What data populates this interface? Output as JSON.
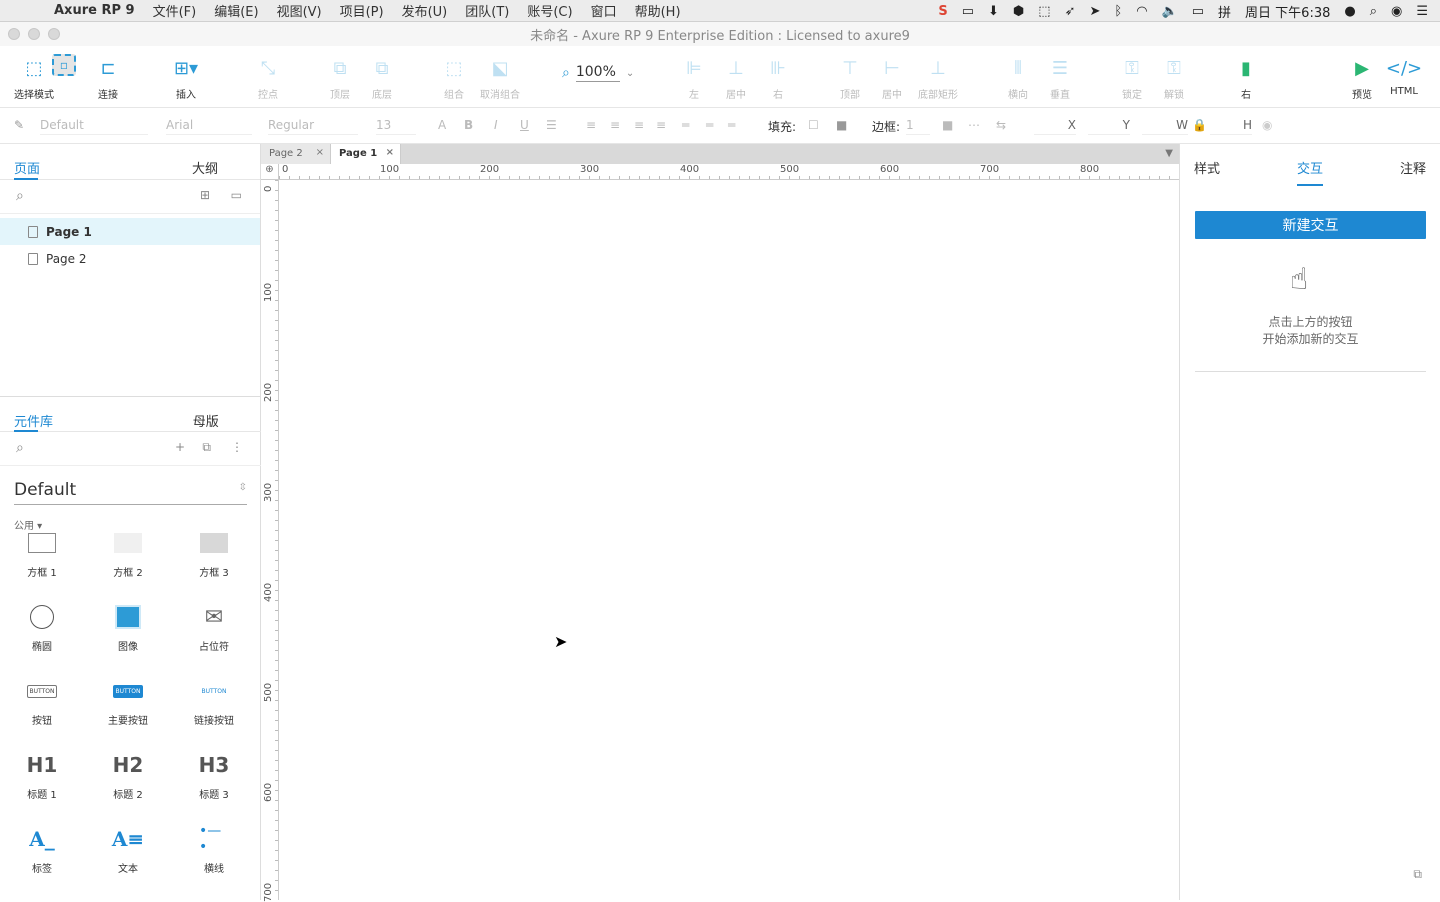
{
  "menubar": {
    "app_name": "Axure RP 9",
    "items": [
      "文件(F)",
      "编辑(E)",
      "视图(V)",
      "项目(P)",
      "发布(U)",
      "团队(T)",
      "账号(C)",
      "窗口",
      "帮助(H)"
    ],
    "clock": "周日 下午6:38"
  },
  "window": {
    "title": "未命名 - Axure RP 9 Enterprise Edition : Licensed to axure9"
  },
  "toolbar": {
    "select_mode": "选择模式",
    "connect": "连接",
    "insert": "插入",
    "points": "控点",
    "top": "顶层",
    "bottom": "底层",
    "group": "组合",
    "ungroup": "取消组合",
    "zoom": "100%",
    "align_left": "左",
    "align_center": "居中",
    "align_right": "右",
    "align_top": "顶部",
    "align_middle": "居中",
    "align_bottom": "底部矩形",
    "dist_h": "横向",
    "dist_v": "垂直",
    "lock": "锁定",
    "unlock": "解锁",
    "right": "右",
    "preview": "预览",
    "html": "HTML"
  },
  "formatbar": {
    "style": "Default",
    "font": "Arial",
    "weight": "Regular",
    "size": "13",
    "fill_label": "填充:",
    "border_label": "边框:",
    "border_value": "1",
    "x": "X",
    "y": "Y",
    "w": "W",
    "h": "H"
  },
  "left": {
    "tab_pages": "页面",
    "tab_outline": "大纲",
    "pages": [
      "Page 1",
      "Page 2"
    ],
    "tab_library": "元件库",
    "tab_masters": "母版",
    "library_name": "Default",
    "category": "公用 ▾",
    "widgets": [
      "方框 1",
      "方框 2",
      "方框 3",
      "椭圆",
      "图像",
      "占位符",
      "按钮",
      "主要按钮",
      "链接按钮",
      "标题 1",
      "标题 2",
      "标题 3",
      "标签",
      "文本",
      "横线"
    ],
    "button_text": "BUTTON",
    "h1": "H1",
    "h2": "H2",
    "h3": "H3"
  },
  "canvas": {
    "tabs": [
      "Page 2",
      "Page 1"
    ],
    "hruler": [
      "0",
      "100",
      "200",
      "300",
      "400",
      "500",
      "600",
      "700",
      "800"
    ],
    "vruler": [
      "0",
      "100",
      "200",
      "300",
      "400",
      "500",
      "600",
      "700"
    ]
  },
  "right": {
    "tab_style": "样式",
    "tab_interact": "交互",
    "tab_notes": "注释",
    "new_interaction": "新建交互",
    "hint_line1": "点击上方的按钮",
    "hint_line2": "开始添加新的交互"
  }
}
